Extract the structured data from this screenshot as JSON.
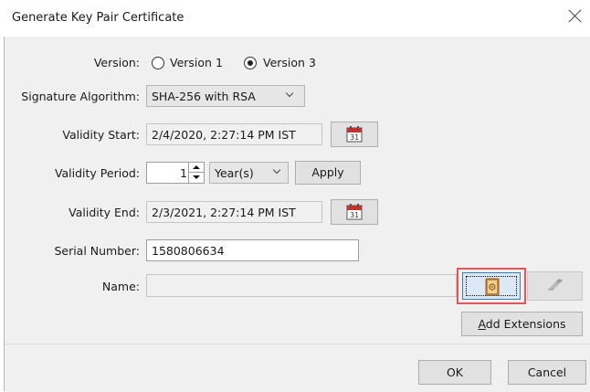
{
  "window": {
    "title": "Generate Key Pair Certificate"
  },
  "version": {
    "label": "Version:",
    "options": [
      {
        "label": "Version 1",
        "selected": false
      },
      {
        "label": "Version 3",
        "selected": true
      }
    ]
  },
  "signature_algorithm": {
    "label": "Signature Algorithm:",
    "value": "SHA-256 with RSA"
  },
  "validity_start": {
    "label": "Validity Start:",
    "value": "2/4/2020, 2:27:14 PM IST"
  },
  "validity_period": {
    "label": "Validity Period:",
    "amount": "1",
    "unit": "Year(s)",
    "apply_label": "Apply"
  },
  "validity_end": {
    "label": "Validity End:",
    "value": "2/3/2021, 2:27:14 PM IST"
  },
  "serial_number": {
    "label": "Serial Number:",
    "value": "1580806634"
  },
  "name": {
    "label": "Name:",
    "value": ""
  },
  "add_extensions": {
    "mnemonic": "A",
    "rest": "dd Extensions"
  },
  "footer": {
    "ok_label": "OK",
    "cancel_label": "Cancel"
  },
  "colors": {
    "highlight": "#e0545a",
    "calendar_red": "#c9302c",
    "dialog_bg": "#f0f0f0"
  }
}
